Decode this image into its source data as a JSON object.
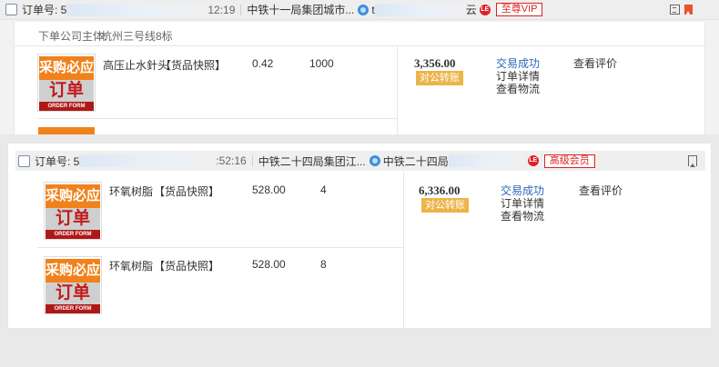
{
  "order1": {
    "order_no_label": "订单号: 5",
    "time": "12:19",
    "buyer_company": "中铁十一局集团城市...",
    "seller_short": "t",
    "seller_tail": "云",
    "vip_label": "至尊VIP",
    "entity_label": "下单公司主体:",
    "entity_value": "杭州三号线8标",
    "item": {
      "name": "高压止水針头",
      "tag": "【货品快照】",
      "price": "0.42",
      "qty": "1000"
    },
    "total": "3,356.00",
    "pay_badge": "对公转账",
    "status": "交易成功",
    "detail_link": "订单详情",
    "logistics_link": "查看物流",
    "review_link": "查看评价"
  },
  "order2": {
    "order_no_label": "订单号: 5",
    "time": ":52:16",
    "buyer_company": "中铁二十四局集团江...",
    "seller_name": "中铁二十四局",
    "vip_label": "高级会员",
    "items": [
      {
        "name": "环氧树脂",
        "tag": "【货品快照】",
        "price": "528.00",
        "qty": "4"
      },
      {
        "name": "环氧树脂",
        "tag": "【货品快照】",
        "price": "528.00",
        "qty": "8"
      }
    ],
    "total": "6,336.00",
    "pay_badge": "对公转账",
    "status": "交易成功",
    "detail_link": "订单详情",
    "logistics_link": "查看物流",
    "review_link": "查看评价"
  },
  "product_image": {
    "line1": "采购必应",
    "line2": "订单",
    "line3": "ORDER FORM"
  },
  "icons": {
    "wangwang": "wangwang-icon",
    "seller_badge": "seller-badge-icon",
    "badge_text": "LE"
  },
  "colors": {
    "vip_red": "#dd2222",
    "badge_gold": "#ebb54a",
    "link_blue": "#2a66b8",
    "image_orange": "#f0821c"
  }
}
